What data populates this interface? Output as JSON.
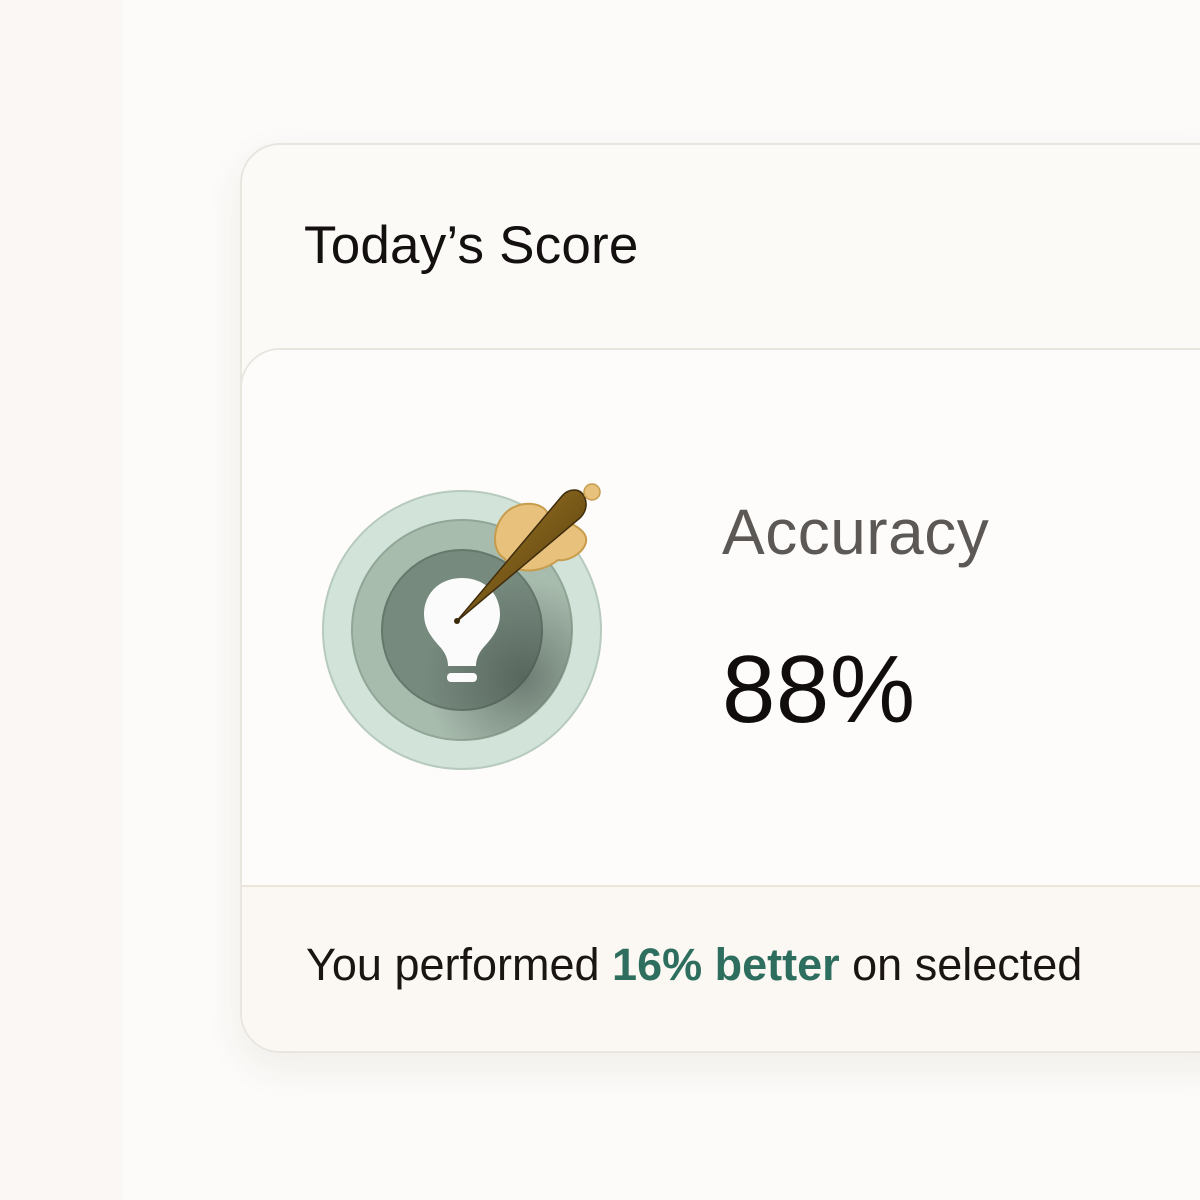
{
  "card": {
    "title": "Today’s Score"
  },
  "metric": {
    "icon": "target-dart-lightbulb-icon",
    "label": "Accuracy",
    "value": "88%"
  },
  "footer": {
    "prefix": "You performed ",
    "highlight": "16% better",
    "suffix": " on selected"
  },
  "colors": {
    "highlight": "#2e6e5e",
    "ring_outer": "#d2e3d9",
    "ring_middle": "#a8bcae",
    "ring_inner": "#778a7e",
    "dart_shaft": "#7a5a18",
    "dart_flight": "#e8c27c"
  }
}
